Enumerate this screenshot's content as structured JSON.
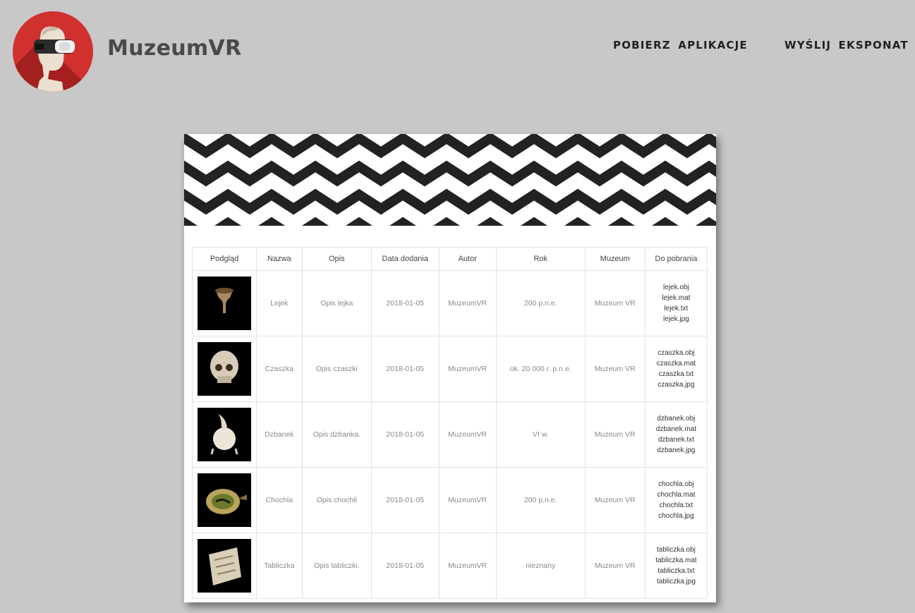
{
  "brand": {
    "name": "MuzeumVR"
  },
  "nav": {
    "download_app": "POBIERZ APLIKACJE",
    "send_exhibit": "WYŚLIJ EKSPONAT"
  },
  "table": {
    "headers": [
      "Podgląd",
      "Nazwa",
      "Opis",
      "Data dodania",
      "Autor",
      "Rok",
      "Muzeum",
      "Do pobrania"
    ],
    "rows": [
      {
        "name": "Lejek",
        "desc": "Opis lejka",
        "date": "2018-01-05",
        "author": "MuzeumVR",
        "year": "200 p.n.e.",
        "museum": "Muzeum VR",
        "files": [
          "lejek.obj",
          "lejek.mat",
          "lejek.txt",
          "lejek.jpg"
        ]
      },
      {
        "name": "Czaszka",
        "desc": "Opis czaszki",
        "date": "2018-01-05",
        "author": "MuzeumVR",
        "year": "ok. 20 000 r. p.n.e.",
        "museum": "Muzeum VR",
        "files": [
          "czaszka.obj",
          "czaszka.mat",
          "czaszka.txt",
          "czaszka.jpg"
        ]
      },
      {
        "name": "Dzbanek",
        "desc": "Opis dzbanka.",
        "date": "2018-01-05",
        "author": "MuzeumVR",
        "year": "VI w.",
        "museum": "Muzeum VR",
        "files": [
          "dzbanek.obj",
          "dzbanek.mat",
          "dzbanek.txt",
          "dzbanek.jpg"
        ]
      },
      {
        "name": "Chochla",
        "desc": "Opis chochli",
        "date": "2018-01-05",
        "author": "MuzeumVR",
        "year": "200 p.n.e.",
        "museum": "Muzeum VR",
        "files": [
          "chochla.obj",
          "chochla.mat",
          "chochla.txt",
          "chochla.jpg"
        ]
      },
      {
        "name": "Tabliczka",
        "desc": "Opis tabliczki.",
        "date": "2018-01-05",
        "author": "MuzeumVR",
        "year": "nieznany",
        "museum": "Muzeum VR",
        "files": [
          "tabliczka.obj",
          "tabliczka.mat",
          "tabliczka.txt",
          "tabliczka.jpg"
        ]
      }
    ]
  }
}
